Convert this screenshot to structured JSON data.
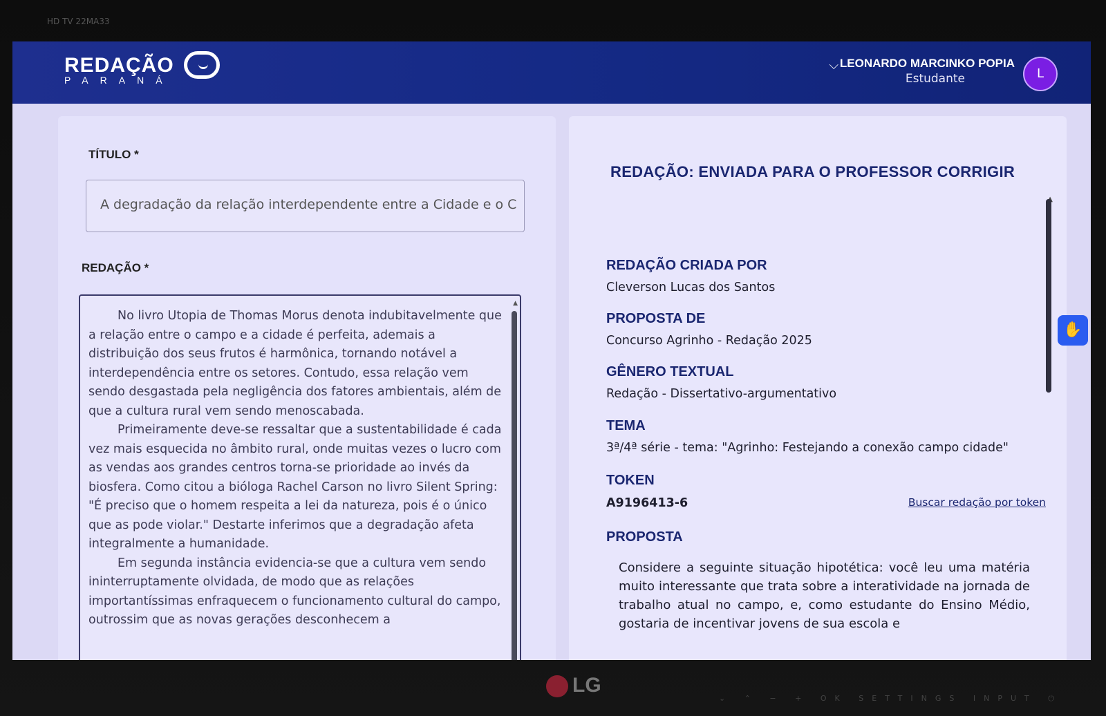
{
  "monitor": {
    "model_label": "HD TV 22MA33",
    "brand": "LG",
    "controls": "⌄ ⌃ − + OK SETTINGS INPUT ⏻"
  },
  "header": {
    "logo_main": "REDAÇÃO",
    "logo_sub": "PARANÁ",
    "user_name": "LEONARDO MARCINKO POPIA",
    "user_role": "Estudante",
    "avatar_initial": "L"
  },
  "form": {
    "title_label": "TÍTULO *",
    "title_value": "A degradação da relação interdependente entre a Cidade e o C",
    "essay_label": "REDAÇÃO *",
    "essay_paragraphs": [
      "No livro Utopia de Thomas Morus denota indubitavelmente que a relação entre o campo e a cidade é perfeita, ademais a distribuição dos seus frutos é harmônica, tornando notável a interdependência entre os setores. Contudo, essa relação vem sendo desgastada pela negligência dos fatores ambientais, além de que a cultura rural vem sendo menoscabada.",
      "Primeiramente deve-se ressaltar que a sustentabilidade é cada vez mais esquecida no âmbito rural, onde muitas vezes o lucro com as vendas aos grandes centros torna-se prioridade ao invés da biosfera. Como citou a bióloga Rachel Carson no livro Silent Spring: \"É preciso que o homem respeita a lei da natureza, pois é o único que as pode violar.\" Destarte inferimos que a degradação afeta integralmente a humanidade.",
      "Em segunda instância evidencia-se que a cultura vem sendo ininterruptamente olvidada, de modo que as relações importantíssimas enfraquecem o funcionamento cultural do campo, outrossim que as novas gerações desconhecem a"
    ]
  },
  "details": {
    "status": "REDAÇÃO: ENVIADA PARA O PROFESSOR CORRIGIR",
    "created_by_label": "REDAÇÃO CRIADA POR",
    "created_by_value": "Cleverson Lucas dos Santos",
    "proposal_of_label": "PROPOSTA DE",
    "proposal_of_value": "Concurso Agrinho - Redação 2025",
    "genre_label": "GÊNERO TEXTUAL",
    "genre_value": "Redação - Dissertativo-argumentativo",
    "theme_label": "TEMA",
    "theme_value": "3ª/4ª série - tema: \"Agrinho: Festejando a conexão campo cidade\"",
    "token_label": "TOKEN",
    "token_value": "A9196413-6",
    "token_link": "Buscar redação por token",
    "proposal_label": "PROPOSTA",
    "proposal_text": "Considere a seguinte situação hipotética: você leu uma matéria muito interessante que trata sobre a interatividade na jornada de trabalho atual no campo, e, como estudante do Ensino Médio, gostaria de incentivar jovens de sua escola e"
  },
  "icons": {
    "accessibility": "hand-sign-language-icon",
    "dropdown": "chevron-down-icon"
  },
  "colors": {
    "header_bg": "#152a86",
    "accent_blue": "#1a2670",
    "avatar_bg": "#7a1ee3",
    "a11y_btn": "#2a5cf0"
  }
}
